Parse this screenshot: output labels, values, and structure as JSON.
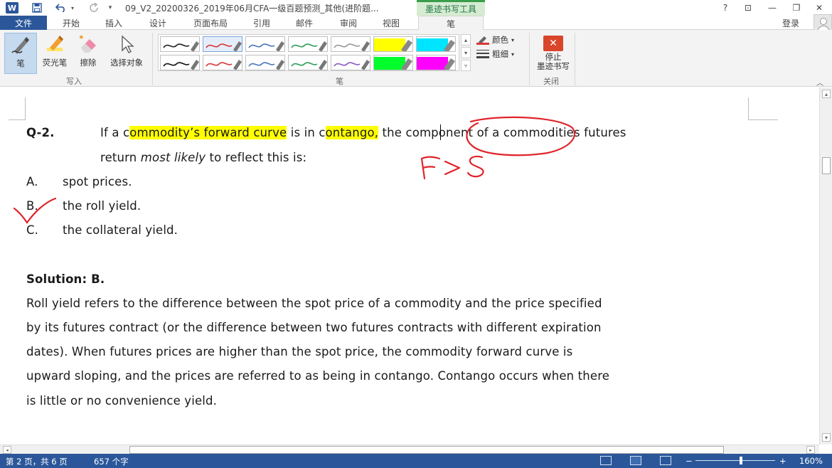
{
  "titlebar": {
    "app_logo": "W",
    "doc_title": "09_V2_20200326_2019年06月CFA一级百题预测_其他(进阶题...",
    "context_tab": "墨迹书写工具",
    "help": "?",
    "ribbon_display": "⊡",
    "minimize": "—",
    "maximize": "❐",
    "close": "✕"
  },
  "tabs": {
    "file": "文件",
    "home": "开始",
    "insert": "插入",
    "design": "设计",
    "layout": "页面布局",
    "references": "引用",
    "mailings": "邮件",
    "review": "审阅",
    "view": "视图",
    "pen": "笔",
    "login": "登录"
  },
  "ribbon": {
    "pen": "笔",
    "highlighter": "荧光笔",
    "eraser": "擦除",
    "select_objects": "选择对象",
    "group_write": "写入",
    "group_pen": "笔",
    "color": "颜色",
    "thickness": "粗细",
    "stop_line1": "停止",
    "stop_line2": "墨迹书写",
    "group_close": "关闭",
    "pen_swatches": [
      {
        "color": "#222222",
        "kind": "pen",
        "selected": false
      },
      {
        "color": "#d9383a",
        "kind": "pen",
        "selected": true
      },
      {
        "color": "#4a76b8",
        "kind": "pen",
        "selected": false
      },
      {
        "color": "#2f9e5b",
        "kind": "pen",
        "selected": false
      },
      {
        "color": "#999999",
        "kind": "pen",
        "selected": false
      },
      {
        "color": "#ffff00",
        "kind": "highlighter",
        "selected": false
      },
      {
        "color": "#00e5ff",
        "kind": "highlighter",
        "selected": false
      },
      {
        "color": "#111111",
        "kind": "pen",
        "selected": false
      },
      {
        "color": "#d9383a",
        "kind": "pen",
        "selected": false
      },
      {
        "color": "#4a76b8",
        "kind": "pen",
        "selected": false
      },
      {
        "color": "#2f9e5b",
        "kind": "pen",
        "selected": false
      },
      {
        "color": "#8a5cc0",
        "kind": "pen",
        "selected": false
      },
      {
        "color": "#00ff2a",
        "kind": "highlighter",
        "selected": false
      },
      {
        "color": "#ff00ff",
        "kind": "highlighter",
        "selected": false
      }
    ]
  },
  "document": {
    "q_label": "Q-2.",
    "q_l1_a": "If a c",
    "q_l1_hl1": "ommodity’s forward curve",
    "q_l1_b": " is in c",
    "q_l1_hl2": "ontango,",
    "q_l1_c": " the component of a commodities futures",
    "q_l2_a": "return ",
    "q_l2_i": "most likely",
    "q_l2_b": " to reflect this is:",
    "opt_a_label": "A.",
    "opt_a_text": "spot prices.",
    "opt_b_label": "B.",
    "opt_b_text": "the roll yield.",
    "opt_c_label": "C.",
    "opt_c_text": "the collateral yield.",
    "solution_heading": "Solution: B.",
    "sol_lines": [
      "Roll yield refers to the difference between the spot price of a commodity and the price specified",
      "by its futures contract (or the difference between two futures contracts with different expiration",
      "dates). When futures prices are higher than the spot price, the commodity forward curve is",
      "upward sloping, and the prices are referred to as being in contango. Contango occurs when there",
      "is little or no convenience yield."
    ],
    "ink_color": "#e0242b"
  },
  "statusbar": {
    "page": "第 2 页，共 6 页",
    "words": "657 个字",
    "zoom_minus": "−",
    "zoom_plus": "+",
    "zoom": "160%",
    "zoom_level_percent": 160
  }
}
